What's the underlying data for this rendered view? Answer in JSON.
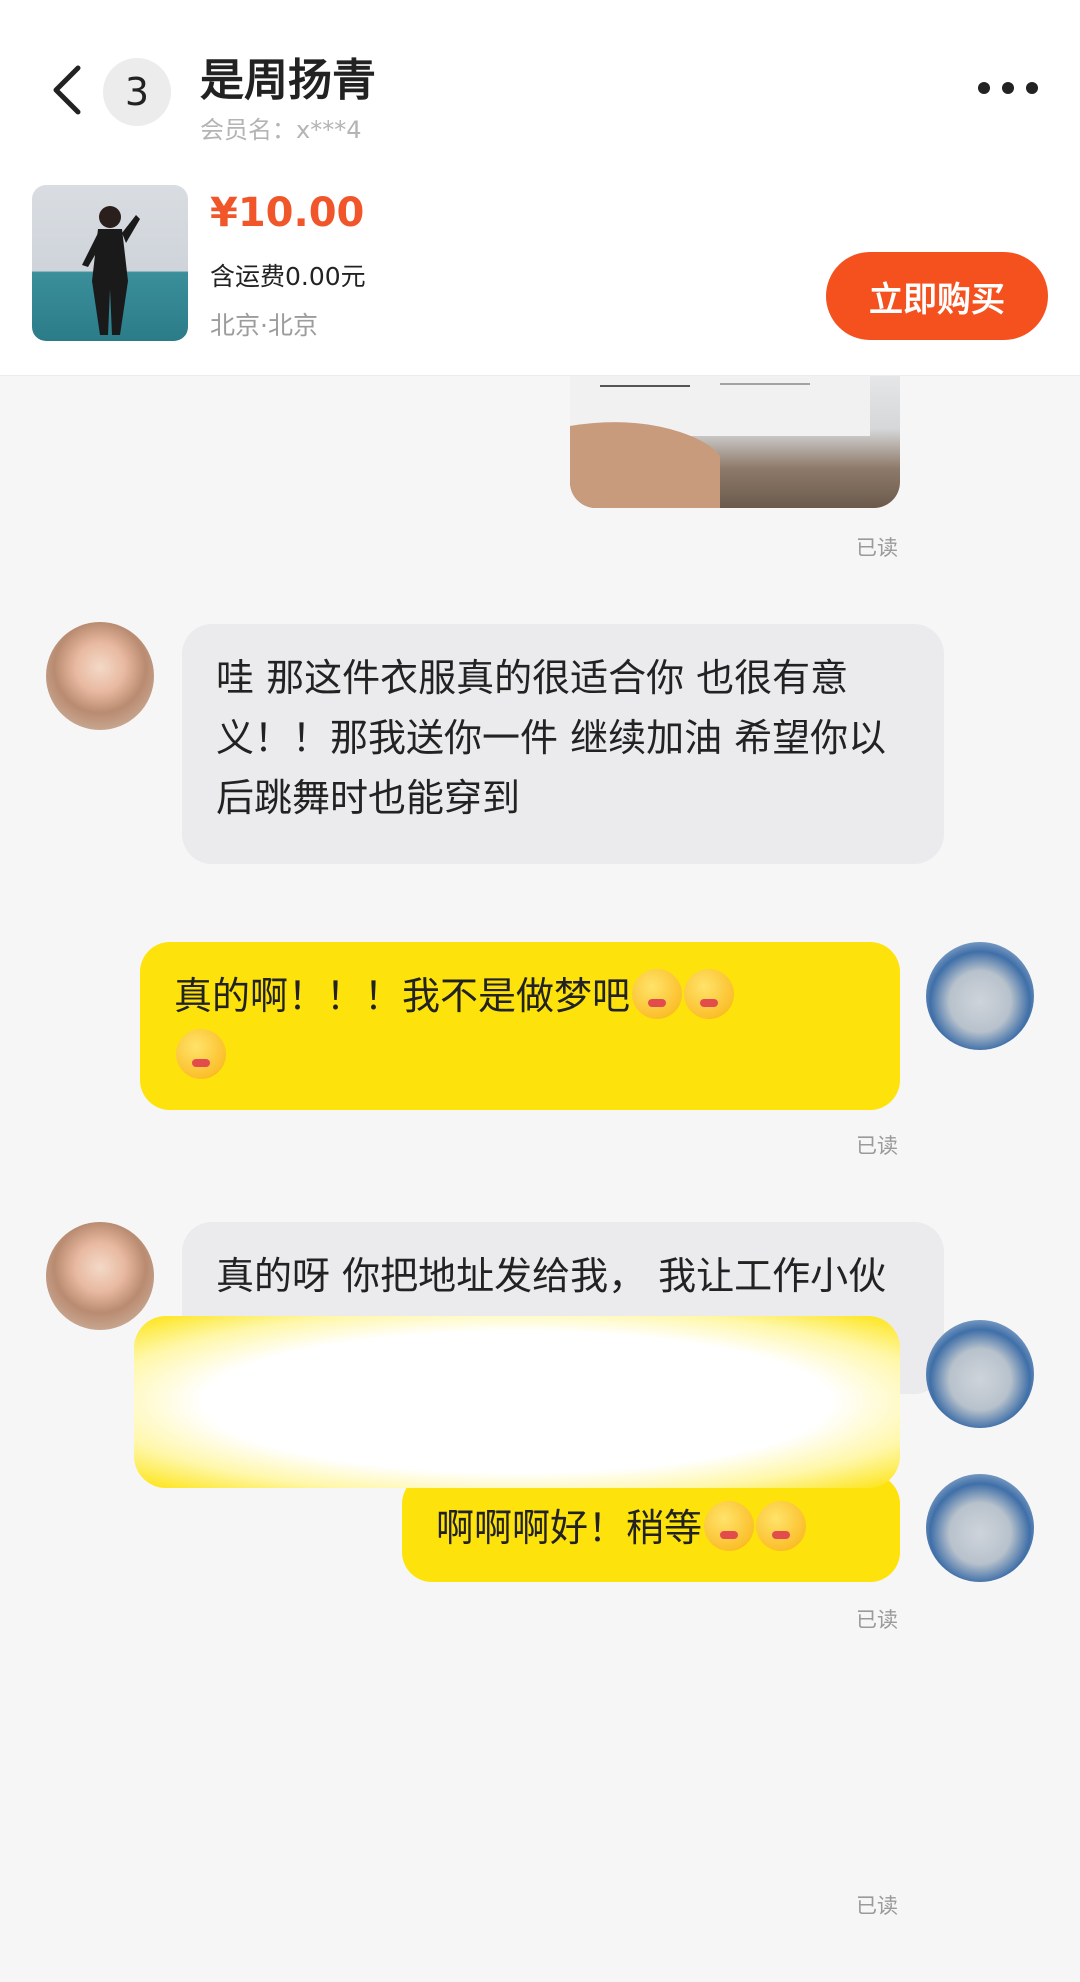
{
  "header": {
    "unread_count": "3",
    "title": "是周扬青",
    "member_label": "会员名：x***4"
  },
  "product": {
    "price": "¥10.00",
    "shipping": "含运费0.00元",
    "location": "北京·北京",
    "buy_label": "立即购买"
  },
  "messages": {
    "read_label": "已读",
    "m1": "哇 那这件衣服真的很适合你 也很有意义！！那我送你一件 继续加油 希望你以后跳舞时也能穿到",
    "m2": "真的啊！！！我不是做梦吧",
    "m3": "真的呀 你把地址发给我， 我让工作小伙伴们给你发",
    "m4": "啊啊啊好！稍等"
  },
  "colors": {
    "accent": "#f4511e",
    "price": "#f0562a",
    "outgoing_bubble": "#fde30b",
    "incoming_bubble": "#ebebed"
  },
  "icons": {
    "back": "chevron-left-icon",
    "more": "more-dots-icon",
    "emoji": "crying-face-emoji"
  }
}
